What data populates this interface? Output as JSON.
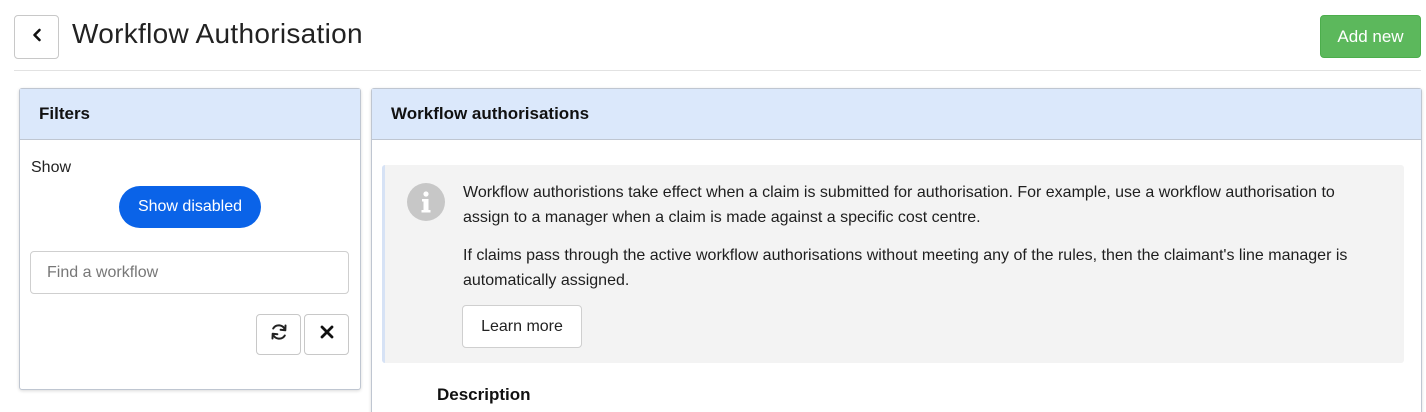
{
  "header": {
    "title": "Workflow Authorisation",
    "back_icon": "chevron-left-icon",
    "add_button": "Add new",
    "add_color": "#5cb85c"
  },
  "filters": {
    "title": "Filters",
    "show_label": "Show",
    "show_disabled_button": "Show disabled",
    "show_disabled_color": "#0a63e8",
    "search_placeholder": "Find a workflow",
    "search_value": "",
    "refresh_icon": "refresh-icon",
    "clear_icon": "close-icon"
  },
  "main": {
    "title": "Workflow authorisations",
    "info": {
      "icon": "info-icon",
      "paragraph1": "Workflow authoristions take effect when a claim is submitted for authorisation. For example, use a workflow authorisation to assign to a manager when a claim is made against a specific cost centre.",
      "paragraph2": "If claims pass through the active workflow authorisations without meeting any of the rules, then the claimant's line manager is automatically assigned.",
      "learn_more": "Learn more"
    },
    "description_heading": "Description"
  },
  "colors": {
    "panel_header_bg": "#dbe8fb",
    "info_bg": "#f3f3f3"
  }
}
